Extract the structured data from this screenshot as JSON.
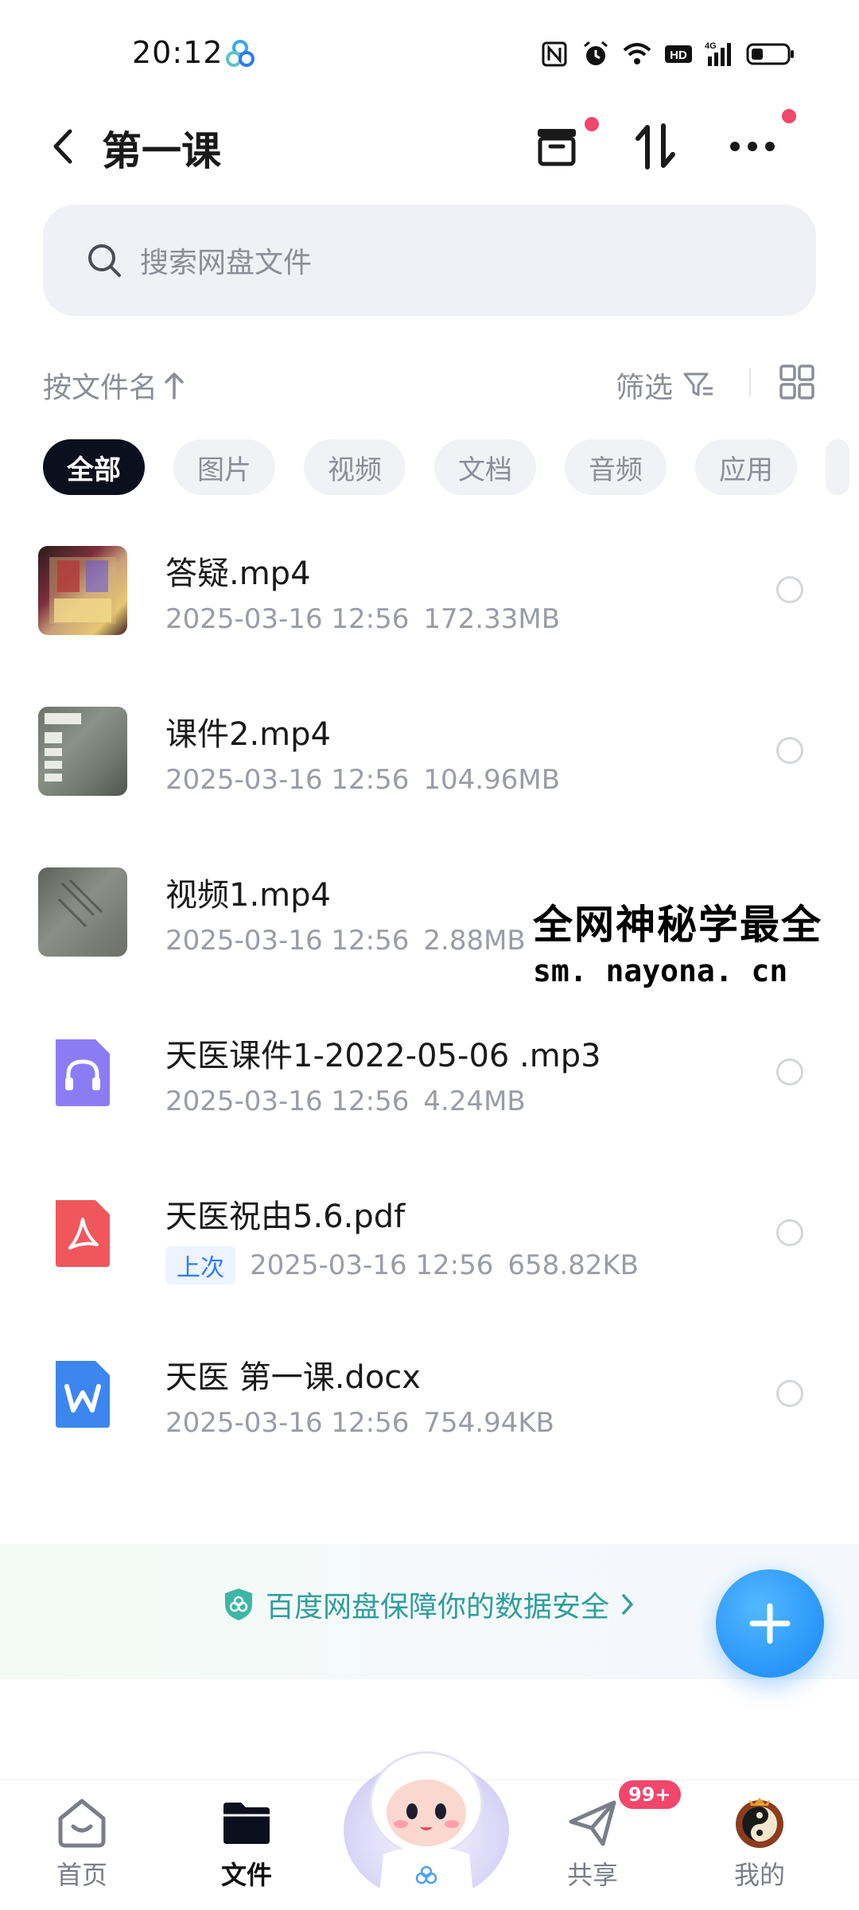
{
  "status_bar": {
    "time": "20:12"
  },
  "header": {
    "title": "第一课"
  },
  "search": {
    "placeholder": "搜索网盘文件"
  },
  "sort": {
    "label": "按文件名",
    "filter_label": "筛选"
  },
  "chips": [
    "全部",
    "图片",
    "视频",
    "文档",
    "音频",
    "应用"
  ],
  "files": [
    {
      "name": "答疑.mp4",
      "date": "2025-03-16  12:56",
      "size": "172.33MB",
      "type": "video"
    },
    {
      "name": "课件2.mp4",
      "date": "2025-03-16  12:56",
      "size": "104.96MB",
      "type": "video"
    },
    {
      "name": "视频1.mp4",
      "date": "2025-03-16  12:56",
      "size": "2.88MB",
      "type": "video"
    },
    {
      "name": "天医课件1-2022-05-06 .mp3",
      "date": "2025-03-16  12:56",
      "size": "4.24MB",
      "type": "audio"
    },
    {
      "name": "天医祝由5.6.pdf",
      "tag": "上次",
      "date": "2025-03-16  12:56",
      "size": "658.82KB",
      "type": "pdf"
    },
    {
      "name": "天医 第一课.docx",
      "date": "2025-03-16  12:56",
      "size": "754.94KB",
      "type": "word"
    }
  ],
  "watermark": {
    "line1": "全网神秘学最全",
    "line2": "sm. nayona. cn"
  },
  "security_banner": {
    "text": "百度网盘保障你的数据安全"
  },
  "bottom_nav": {
    "items": [
      {
        "label": "首页"
      },
      {
        "label": "文件"
      },
      {
        "label": "共享"
      },
      {
        "label": "我的"
      }
    ],
    "share_badge": "99+"
  },
  "colors": {
    "accent": "#1687f6",
    "active_chip": "#0c0f1d",
    "badge": "#f2466b",
    "secure_text": "#2f9e9c"
  }
}
